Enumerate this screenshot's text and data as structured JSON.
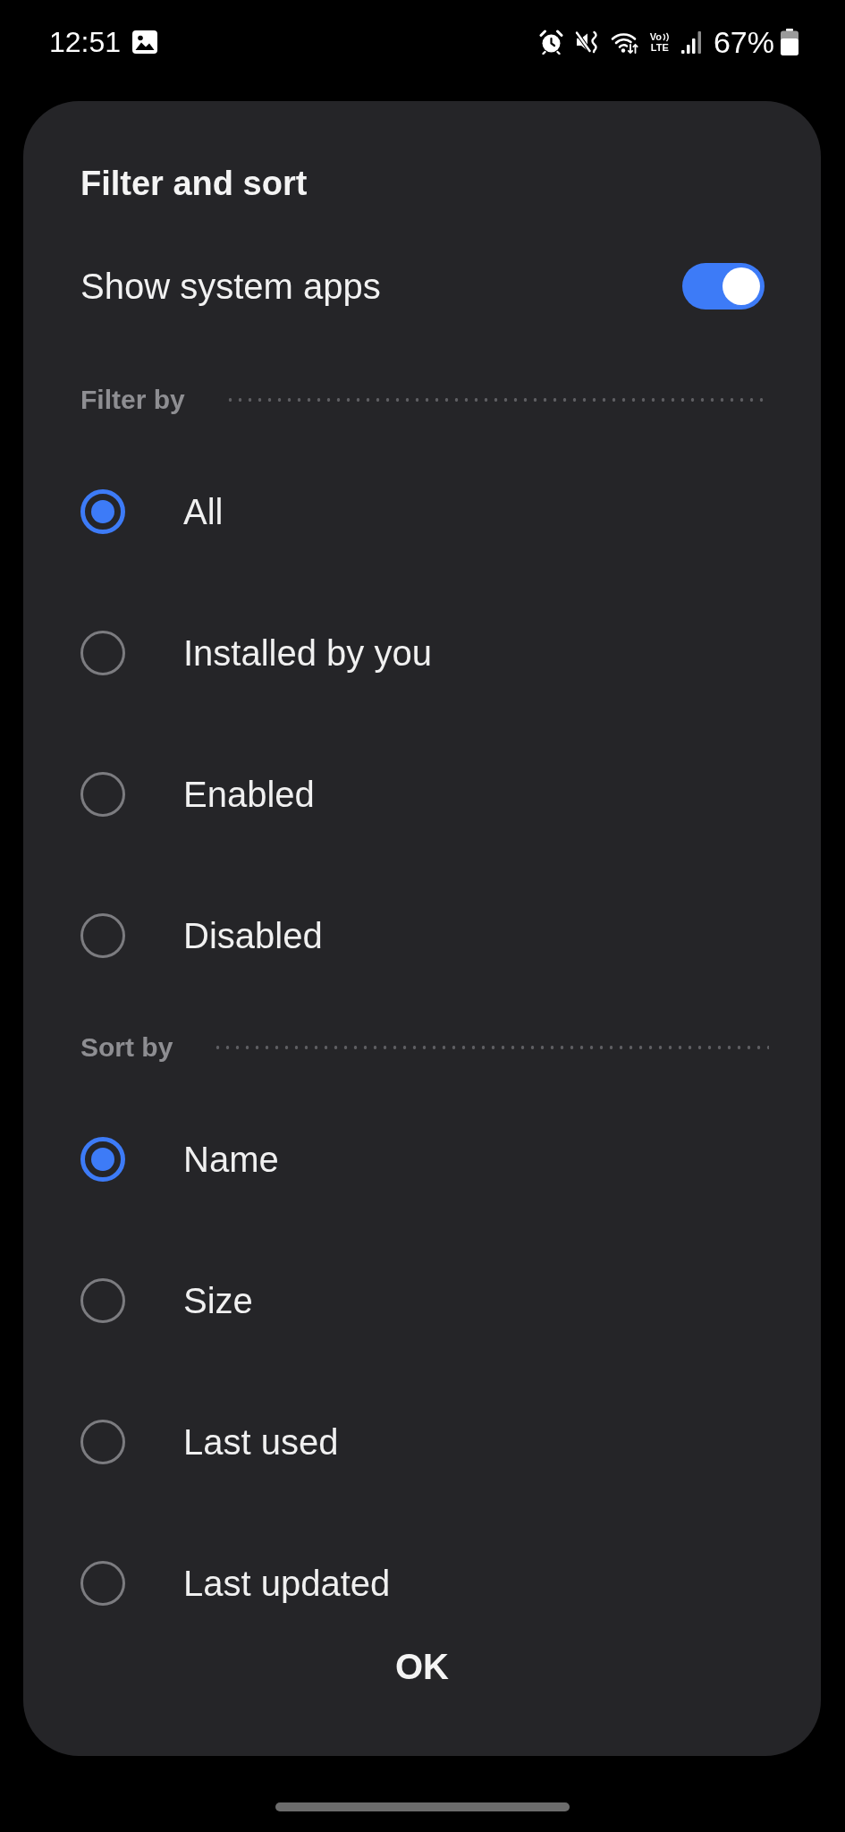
{
  "status_bar": {
    "time": "12:51",
    "voice_label": "Vo",
    "network_type": "LTE",
    "battery": "67%"
  },
  "dialog": {
    "title": "Filter and sort",
    "toggle": {
      "label": "Show system apps",
      "on": true
    },
    "sections": [
      {
        "heading": "Filter by",
        "options": [
          {
            "label": "All",
            "selected": true
          },
          {
            "label": "Installed by you",
            "selected": false
          },
          {
            "label": "Enabled",
            "selected": false
          },
          {
            "label": "Disabled",
            "selected": false
          }
        ]
      },
      {
        "heading": "Sort by",
        "options": [
          {
            "label": "Name",
            "selected": true
          },
          {
            "label": "Size",
            "selected": false
          },
          {
            "label": "Last used",
            "selected": false
          },
          {
            "label": "Last updated",
            "selected": false
          }
        ]
      }
    ],
    "ok_button": "OK"
  }
}
